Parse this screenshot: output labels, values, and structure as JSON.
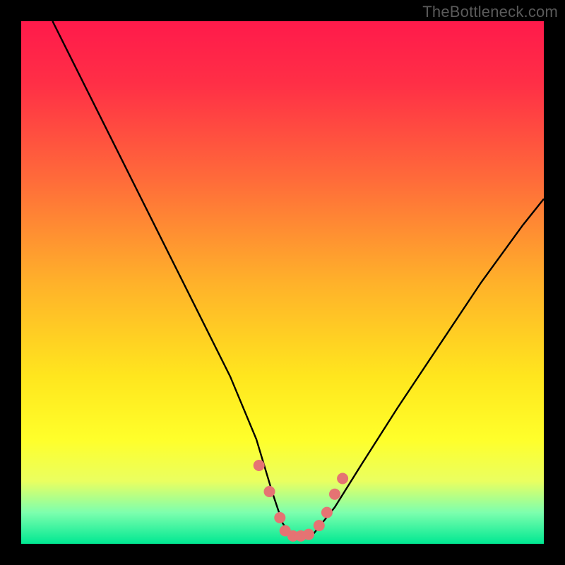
{
  "watermark": {
    "text": "TheBottleneck.com"
  },
  "chart_data": {
    "type": "line",
    "title": "",
    "xlabel": "",
    "ylabel": "",
    "xlim": [
      0,
      100
    ],
    "ylim": [
      0,
      100
    ],
    "background_gradient": {
      "stops": [
        {
          "offset": 0.0,
          "color": "#ff1a4b"
        },
        {
          "offset": 0.12,
          "color": "#ff2f46"
        },
        {
          "offset": 0.3,
          "color": "#ff6a3a"
        },
        {
          "offset": 0.5,
          "color": "#ffb12a"
        },
        {
          "offset": 0.68,
          "color": "#ffe61e"
        },
        {
          "offset": 0.8,
          "color": "#ffff2a"
        },
        {
          "offset": 0.88,
          "color": "#eaff60"
        },
        {
          "offset": 0.94,
          "color": "#7dffae"
        },
        {
          "offset": 1.0,
          "color": "#00e892"
        }
      ]
    },
    "series": [
      {
        "name": "bottleneck-curve",
        "color": "#000000",
        "x": [
          6,
          10,
          15,
          20,
          25,
          30,
          35,
          40,
          45,
          48,
          50,
          52,
          54,
          56,
          60,
          65,
          72,
          80,
          88,
          96,
          100
        ],
        "y": [
          100,
          92,
          82,
          72,
          62,
          52,
          42,
          32,
          20,
          10,
          4,
          1,
          1,
          2,
          7,
          15,
          26,
          38,
          50,
          61,
          66
        ]
      }
    ],
    "points": {
      "name": "marker-dots",
      "color": "#e57373",
      "radius": 8,
      "xy": [
        [
          45.5,
          15
        ],
        [
          47.5,
          10
        ],
        [
          49.5,
          5
        ],
        [
          50.5,
          2.5
        ],
        [
          52.0,
          1.5
        ],
        [
          53.5,
          1.5
        ],
        [
          55.0,
          1.8
        ],
        [
          57.0,
          3.5
        ],
        [
          58.5,
          6
        ],
        [
          60.0,
          9.5
        ],
        [
          61.5,
          12.5
        ]
      ]
    }
  }
}
